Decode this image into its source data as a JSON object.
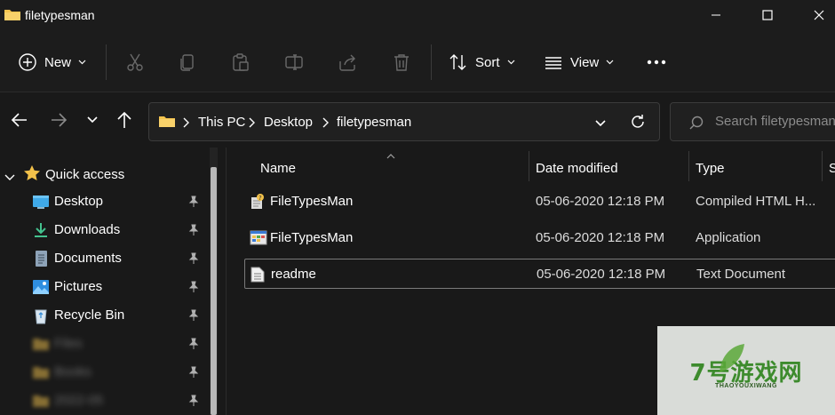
{
  "window": {
    "title": "filetypesman"
  },
  "commandbar": {
    "new_label": "New",
    "sort_label": "Sort",
    "view_label": "View"
  },
  "address": {
    "crumbs": [
      "This PC",
      "Desktop",
      "filetypesman"
    ],
    "search_placeholder": "Search filetypesman"
  },
  "sidebar": {
    "quick_access_label": "Quick access",
    "items": [
      {
        "label": "Desktop",
        "icon": "desktop-icon"
      },
      {
        "label": "Downloads",
        "icon": "downloads-icon"
      },
      {
        "label": "Documents",
        "icon": "documents-icon"
      },
      {
        "label": "Pictures",
        "icon": "pictures-icon"
      },
      {
        "label": "Recycle Bin",
        "icon": "recycle-bin-icon"
      },
      {
        "label": "Files",
        "icon": "folder-icon"
      },
      {
        "label": "Books",
        "icon": "folder-icon"
      },
      {
        "label": "2022-05",
        "icon": "folder-icon"
      }
    ]
  },
  "columns": {
    "name": "Name",
    "date_modified": "Date modified",
    "type": "Type",
    "size": "S"
  },
  "files": [
    {
      "name": "FileTypesMan",
      "date": "05-06-2020 12:18 PM",
      "type": "Compiled HTML H...",
      "icon": "chm-help-icon"
    },
    {
      "name": "FileTypesMan",
      "date": "05-06-2020 12:18 PM",
      "type": "Application",
      "icon": "application-icon"
    },
    {
      "name": "readme",
      "date": "05-06-2020 12:18 PM",
      "type": "Text Document",
      "icon": "text-document-icon"
    }
  ],
  "watermark": {
    "brand": "7号游戏网",
    "sub": "THAOYOUXIWANG"
  },
  "colors": {
    "background": "#191919",
    "folder_yellow": "#f4c44e",
    "accent_blue": "#4aa3f0",
    "watermark_green": "#3d8b2d"
  }
}
